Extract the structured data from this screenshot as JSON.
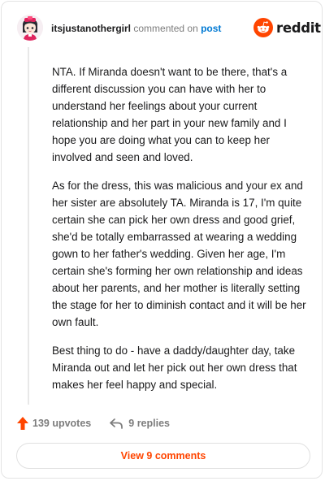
{
  "header": {
    "username": "itsjustanothergirl",
    "action": "commented on",
    "target": "post",
    "brand": "reddit",
    "avatar_icon": "anime-girl-avatar",
    "logo_icon": "reddit-snoo-icon"
  },
  "comment": {
    "paragraphs": [
      "NTA. If Miranda doesn't want to be there, that's a different discussion you can have with her to understand her feelings about your current relationship and her part in your new family and I hope you are doing what you can to keep her involved and seen and loved.",
      "As for the dress, this was malicious and your ex and her sister are absolutely TA. Miranda is 17, I'm quite certain she can pick her own dress and good grief, she'd be totally embarrassed at wearing a wedding gown to her father's wedding. Given her age, I'm certain she's forming her own relationship and ideas about her parents, and her mother is literally setting the stage for her to diminish contact and it will be her own fault.",
      "Best thing to do - have a daddy/daughter day, take Miranda out and let her pick out her own dress that makes her feel happy and special."
    ]
  },
  "actions": {
    "upvotes_label": "139 upvotes",
    "replies_label": "9 replies",
    "upvote_icon": "upvote-arrow-icon",
    "reply_icon": "reply-arrow-icon"
  },
  "footer": {
    "view_comments_label": "View 9 comments"
  },
  "colors": {
    "brand": "#ff4500",
    "link": "#0079d3",
    "muted": "#7c7c7c",
    "text": "#1a1a1b"
  }
}
